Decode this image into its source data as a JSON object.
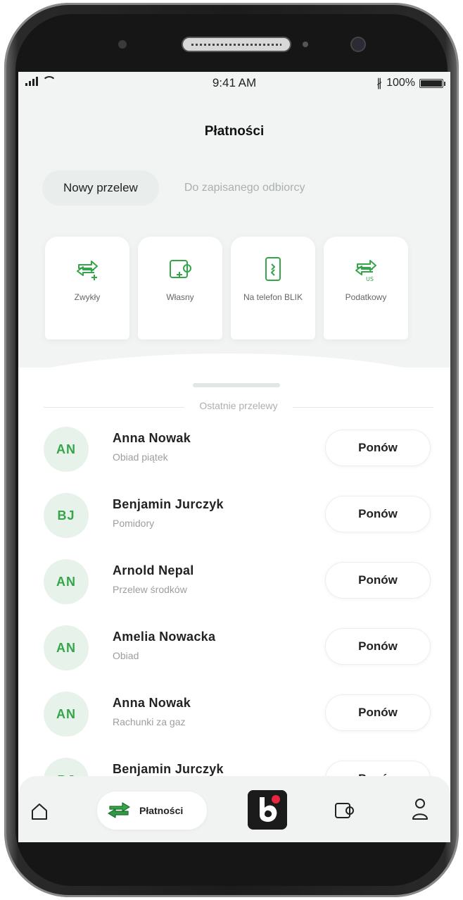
{
  "status_bar": {
    "time": "9:41 AM",
    "battery": "100%"
  },
  "header": {
    "title": "Płatności"
  },
  "tabs": [
    {
      "label": "Nowy przelew",
      "active": true
    },
    {
      "label": "Do zapisanego odbiorcy",
      "active": false
    }
  ],
  "transfer_types": [
    {
      "label": "Zwykły",
      "icon": "arrows-plus-icon"
    },
    {
      "label": "Własny",
      "icon": "wallet-plus-icon"
    },
    {
      "label": "Na telefon BLIK",
      "icon": "phone-blik-icon"
    },
    {
      "label": "Podatkowy",
      "icon": "arrows-us-icon"
    }
  ],
  "recent": {
    "section_label": "Ostatnie przelewy",
    "repeat_label": "Ponów",
    "items": [
      {
        "initials": "AN",
        "name": "Anna Nowak",
        "desc": "Obiad piątek"
      },
      {
        "initials": "BJ",
        "name": "Benjamin Jurczyk",
        "desc": "Pomidory"
      },
      {
        "initials": "AN",
        "name": "Arnold Nepal",
        "desc": "Przelew środków"
      },
      {
        "initials": "AN",
        "name": "Amelia Nowacka",
        "desc": "Obiad"
      },
      {
        "initials": "AN",
        "name": "Anna Nowak",
        "desc": "Rachunki za gaz"
      },
      {
        "initials": "BJ",
        "name": "Benjamin Jurczyk",
        "desc": ""
      }
    ]
  },
  "bottom_nav": {
    "payments_label": "Płatności"
  },
  "colors": {
    "accent_green": "#35a549",
    "avatar_bg": "#e7f2ea",
    "blik_red": "#e8263f"
  }
}
